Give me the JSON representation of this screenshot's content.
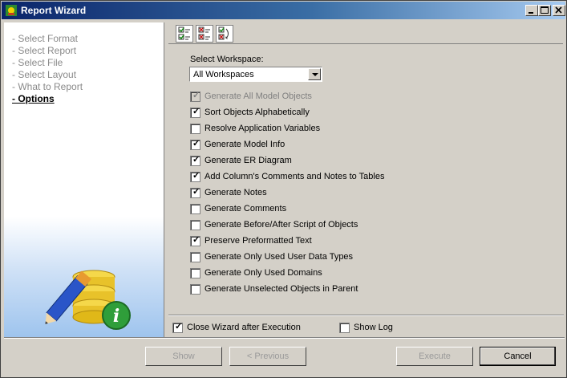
{
  "window": {
    "title": "Report Wizard"
  },
  "nav": [
    {
      "label": "- Select Format",
      "active": false
    },
    {
      "label": "- Select Report",
      "active": false
    },
    {
      "label": "- Select File",
      "active": false
    },
    {
      "label": "- Select Layout",
      "active": false
    },
    {
      "label": "- What to Report",
      "active": false
    },
    {
      "label": "- Options",
      "active": true
    }
  ],
  "workspace": {
    "label": "Select Workspace:",
    "value": "All Workspaces"
  },
  "options": [
    {
      "label": "Generate All Model Objects",
      "checked": true,
      "disabled": true
    },
    {
      "label": "Sort Objects Alphabetically",
      "checked": true,
      "disabled": false
    },
    {
      "label": "Resolve Application Variables",
      "checked": false,
      "disabled": false
    },
    {
      "label": "Generate Model Info",
      "checked": true,
      "disabled": false
    },
    {
      "label": "Generate ER Diagram",
      "checked": true,
      "disabled": false
    },
    {
      "label": "Add Column's Comments and Notes to Tables",
      "checked": true,
      "disabled": false
    },
    {
      "label": "Generate Notes",
      "checked": true,
      "disabled": false
    },
    {
      "label": "Generate Comments",
      "checked": false,
      "disabled": false
    },
    {
      "label": "Generate Before/After Script of Objects",
      "checked": false,
      "disabled": false
    },
    {
      "label": "Preserve Preformatted Text",
      "checked": true,
      "disabled": false
    },
    {
      "label": "Generate Only Used User Data Types",
      "checked": false,
      "disabled": false
    },
    {
      "label": "Generate Only Used Domains",
      "checked": false,
      "disabled": false
    },
    {
      "label": "Generate Unselected Objects in Parent",
      "checked": false,
      "disabled": false
    }
  ],
  "bottom": {
    "close_wizard": {
      "label": "Close Wizard after Execution",
      "checked": true
    },
    "show_log": {
      "label": "Show Log",
      "checked": false
    }
  },
  "buttons": {
    "show": "Show",
    "previous": "< Previous",
    "execute": "Execute",
    "cancel": "Cancel"
  },
  "colors": {
    "titlebar": "#0a246a",
    "dialog": "#d4d0c8",
    "accent": "#3a6ea5"
  }
}
